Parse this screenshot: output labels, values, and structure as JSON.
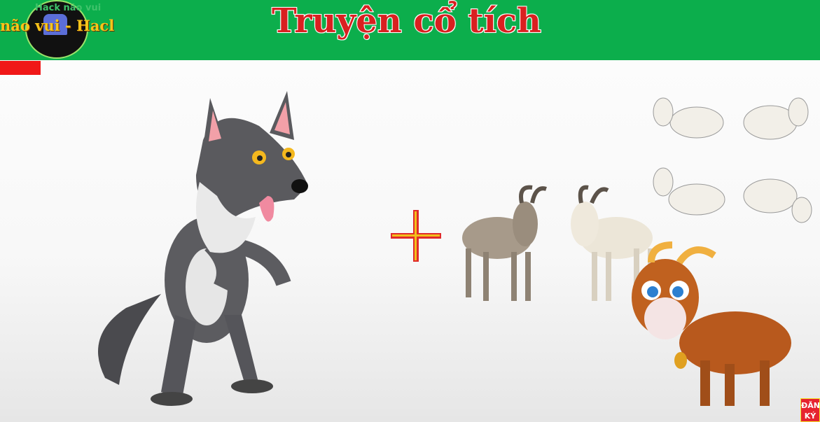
{
  "header": {
    "title": "Truyện cổ tích",
    "logo_text": "Hack não vui",
    "marquee": "não vui - Hacl",
    "bg_color": "#0cae4c",
    "title_color": "#d92020"
  },
  "scene": {
    "characters": [
      "wolf",
      "grey-goat",
      "white-goat",
      "brown-goat",
      "white-goat-poses"
    ],
    "plus_icon": "plus-icon"
  },
  "subscribe": {
    "line1": "ĐĂN",
    "line2": "KÝ"
  }
}
